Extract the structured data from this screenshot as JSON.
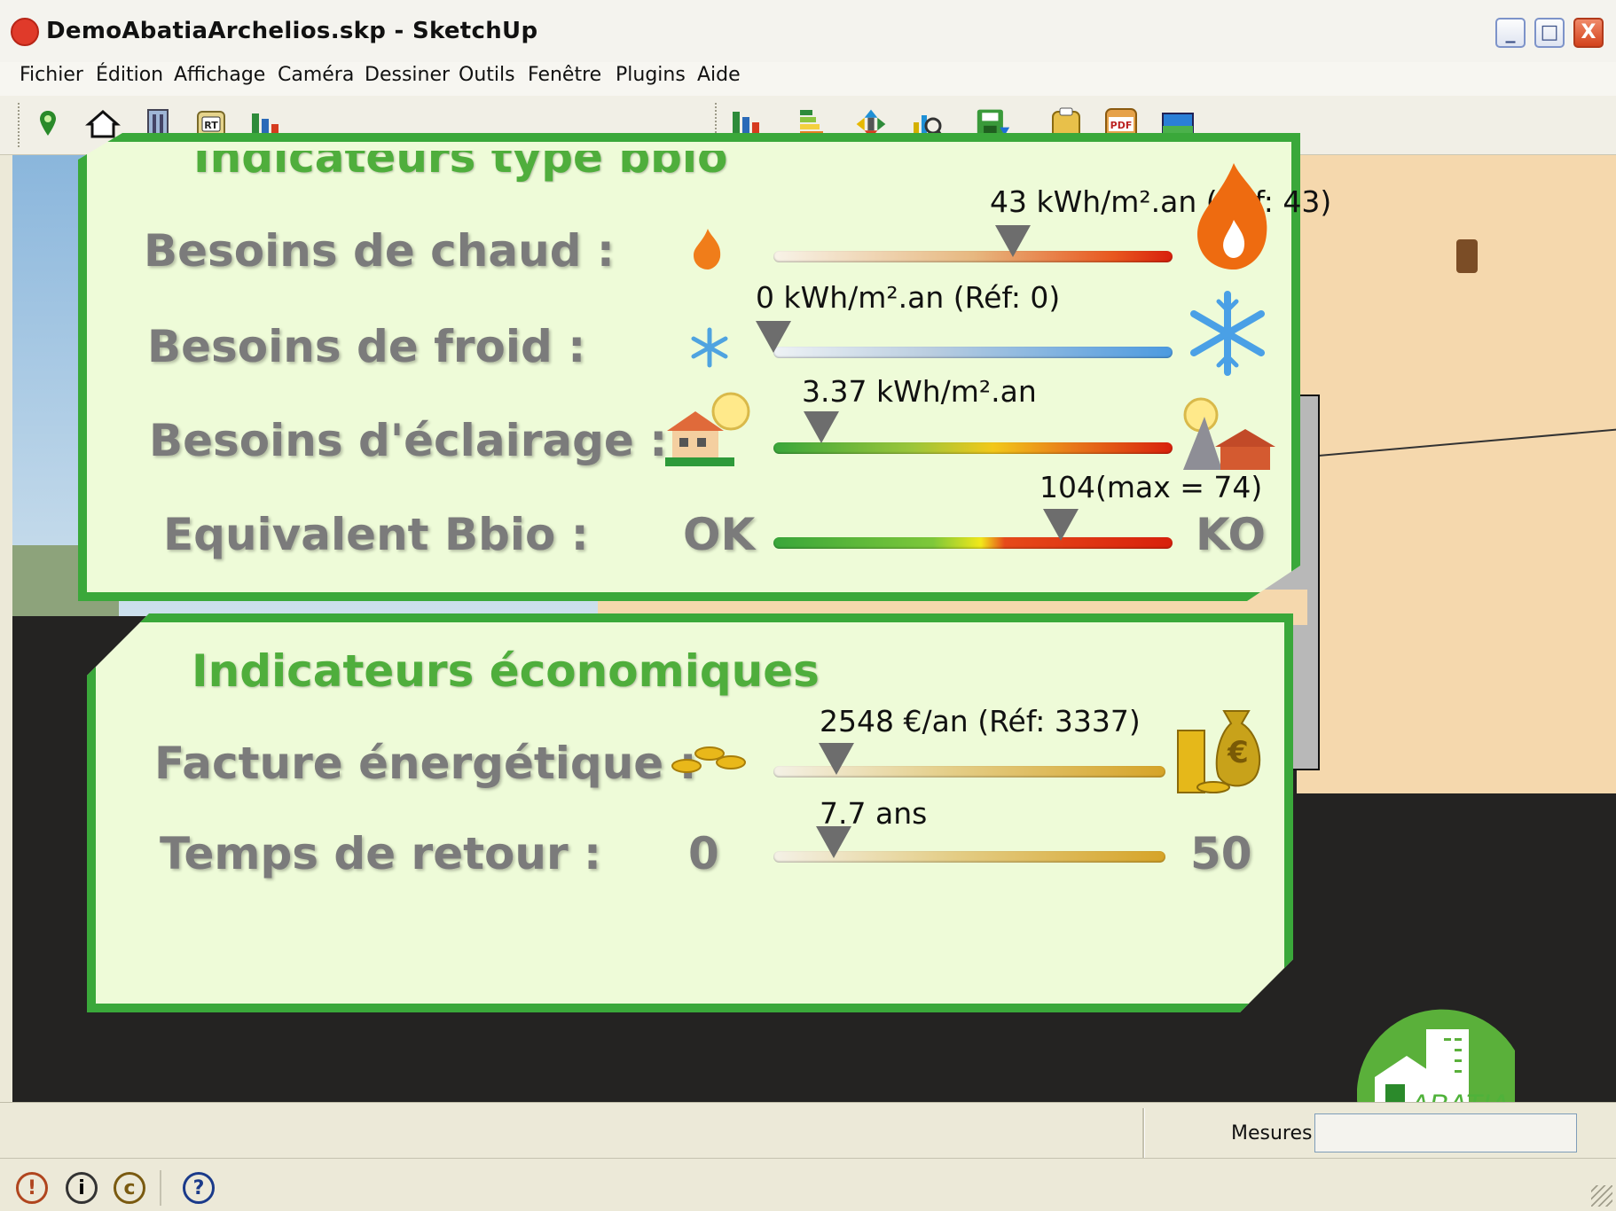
{
  "window": {
    "title": "DemoAbatiaArchelios.skp - SketchUp",
    "controls": {
      "minimize": "_",
      "maximize": "□",
      "close": "X"
    }
  },
  "menu": [
    "Fichier",
    "Édition",
    "Affichage",
    "Caméra",
    "Dessiner",
    "Outils",
    "Fenêtre",
    "Plugins",
    "Aide"
  ],
  "toolbar_left": [
    {
      "name": "location-pin-icon",
      "glyph": "📍"
    },
    {
      "name": "house-icon",
      "glyph": "⌂"
    },
    {
      "name": "building-icon",
      "glyph": "▥"
    },
    {
      "name": "rt-icon",
      "glyph": "RT"
    },
    {
      "name": "bar-chart-icon",
      "glyph": "▮"
    }
  ],
  "toolbar_right": [
    {
      "name": "bar-chart-icon",
      "glyph": "▮"
    },
    {
      "name": "energy-label-icon",
      "glyph": "≡"
    },
    {
      "name": "transform-arrows-icon",
      "glyph": "✥"
    },
    {
      "name": "analysis-chart-icon",
      "glyph": "⌕"
    },
    {
      "name": "save-export-icon",
      "glyph": "⬇"
    },
    {
      "name": "clipboard-icon",
      "glyph": "▣"
    },
    {
      "name": "pdf-icon",
      "glyph": "PDF"
    },
    {
      "name": "image-icon",
      "glyph": "▭"
    }
  ],
  "bbio_panel": {
    "title": "Indicateurs type bbio",
    "rows": [
      {
        "label": "Besoins de chaud :",
        "value_text": "43 kWh/m².an (Réf: 43)",
        "position": 0.6,
        "gradient": "heat",
        "left_icon": "flame-small-icon",
        "right_icon": "flame-large-icon"
      },
      {
        "label": "Besoins de froid :",
        "value_text": "0 kWh/m².an (Réf: 0)",
        "position": 0.0,
        "gradient": "cold",
        "left_icon": "snowflake-small-icon",
        "right_icon": "snowflake-large-icon"
      },
      {
        "label": "Besoins d'éclairage :",
        "value_text": "3.37 kWh/m².an",
        "position": 0.12,
        "gradient": "light",
        "left_icon": "sunny-house-icon",
        "right_icon": "shaded-house-icon"
      },
      {
        "label": "Equivalent Bbio :",
        "value_text": "104(max = 74)",
        "position": 0.72,
        "gradient": "bbio",
        "left_text": "OK",
        "right_text": "KO"
      }
    ]
  },
  "eco_panel": {
    "title": "Indicateurs économiques",
    "rows": [
      {
        "label": "Facture énergétique :",
        "value_text": "2548 €/an (Réf: 3337)",
        "position": 0.16,
        "left_icon": "coins-small-icon",
        "right_icon": "money-bag-icon"
      },
      {
        "label": "Temps de retour :",
        "value_text": "7.7 ans",
        "position": 0.154,
        "left_text": "0",
        "right_text": "50"
      }
    ]
  },
  "status": {
    "mesures_label": "Mesures",
    "mesures_value": ""
  },
  "logo_text": "ABATIA",
  "colors": {
    "panel_bg": "#eefbd8",
    "panel_border": "#3aa83a",
    "title_green": "#4fae3c",
    "label_grey": "#7b7b7b"
  }
}
